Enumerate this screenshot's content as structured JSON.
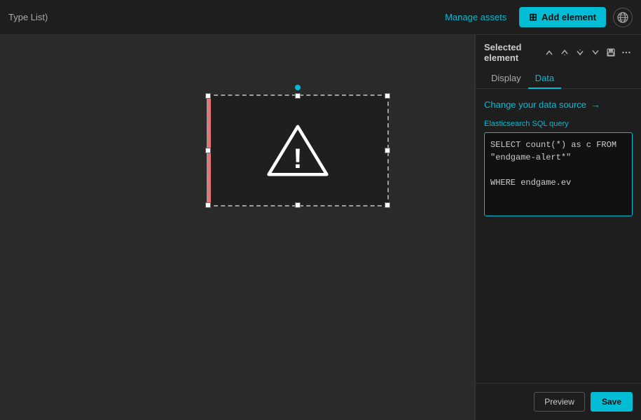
{
  "topbar": {
    "title": "Type List)",
    "manage_assets_label": "Manage assets",
    "add_element_label": "Add element",
    "add_element_icon": "⊞"
  },
  "panel": {
    "title": "Selected element",
    "tabs": [
      {
        "id": "display",
        "label": "Display",
        "active": false
      },
      {
        "id": "data",
        "label": "Data",
        "active": true
      }
    ],
    "change_data_source_label": "Change your data source",
    "query_label": "Elasticsearch SQL query",
    "query_value": "SELECT count(*) as c FROM\n\"endgame-alert*\"\n\nWHERE endgame.ev",
    "preview_label": "Preview",
    "save_label": "Save"
  },
  "nav_arrows": [
    "↑",
    "↑",
    "↓",
    "↓"
  ],
  "colors": {
    "accent": "#00bcd4",
    "left_border": "#e57373",
    "bg_dark": "#1a1a1a",
    "bg_panel": "#1e1e1e"
  }
}
